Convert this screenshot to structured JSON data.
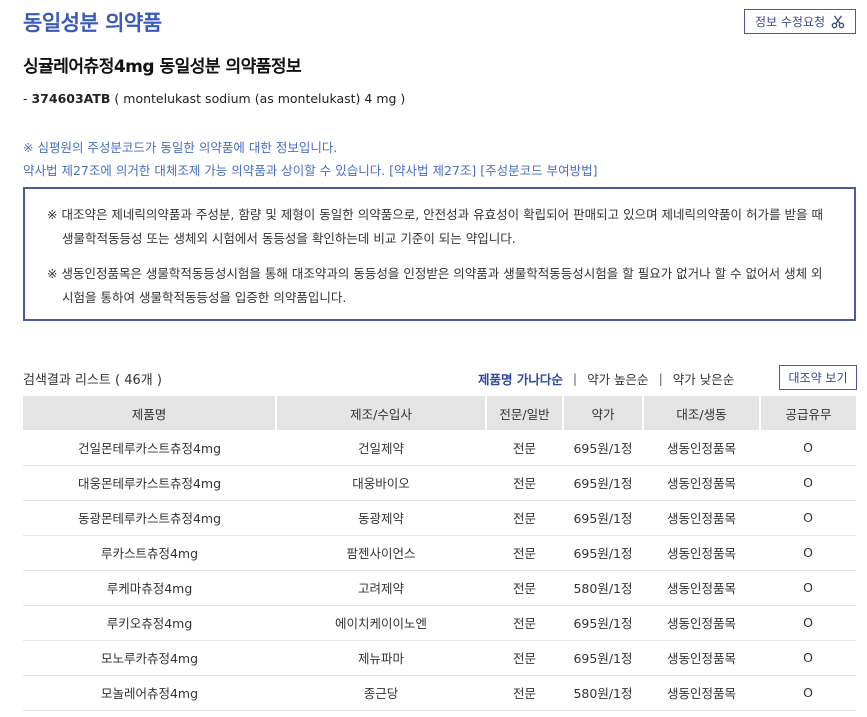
{
  "header": {
    "title": "동일성분 의약품",
    "edit_button": "정보 수정요청"
  },
  "drug": {
    "subtitle": "싱귤레어츄정4mg 동일성분 의약품정보",
    "code_prefix": "- ",
    "code": "374603ATB",
    "ingredient": " ( montelukast sodium (as montelukast) 4 mg )"
  },
  "notes": {
    "line1": "※ 심평원의 주성분코드가 동일한 의약품에 대한 정보입니다.",
    "line2": "약사법 제27조에 의거한 대체조제 가능 의약품과 상이할 수 있습니다.",
    "link1": "[약사법 제27조]",
    "link2": "[주성분코드 부여방법]"
  },
  "infobox": {
    "para1": "※ 대조약은 제네릭의약품과 주성분, 함량 및 제형이 동일한 의약품으로, 안전성과 유효성이 확립되어 판매되고 있으며 제네릭의약품이 허가를 받을 때 생물학적동등성 또는 생체외 시험에서 동등성을 확인하는데 비교 기준이 되는 약입니다.",
    "para2": "※ 생동인정품목은 생물학적동등성시험을 통해 대조약과의 동등성을 인정받은 의약품과 생물학적동등성시험을 할 필요가 없거나 할 수 없어서 생체 외 시험을 통하여 생물학적동등성을 입증한 의약품입니다."
  },
  "list": {
    "label": "검색결과 리스트 ( 46개 )",
    "sort_name": "제품명 가나다순",
    "sort_sep": "|",
    "sort_price_high": "약가 높은순",
    "sort_price_low": "약가 낮은순",
    "compare_button": "대조약 보기",
    "columns": [
      "제품명",
      "제조/수입사",
      "전문/일반",
      "약가",
      "대조/생동",
      "공급유무"
    ],
    "rows": [
      [
        "건일몬테루카스트츄정4mg",
        "건일제약",
        "전문",
        "695원/1정",
        "생동인정품목",
        "O"
      ],
      [
        "대웅몬테루카스트츄정4mg",
        "대웅바이오",
        "전문",
        "695원/1정",
        "생동인정품목",
        "O"
      ],
      [
        "동광몬테루카스트츄정4mg",
        "동광제약",
        "전문",
        "695원/1정",
        "생동인정품목",
        "O"
      ],
      [
        "루카스트츄정4mg",
        "팜젠사이언스",
        "전문",
        "695원/1정",
        "생동인정품목",
        "O"
      ],
      [
        "루케마츄정4mg",
        "고려제약",
        "전문",
        "580원/1정",
        "생동인정품목",
        "O"
      ],
      [
        "루키오츄정4mg",
        "에이치케이이노엔",
        "전문",
        "695원/1정",
        "생동인정품목",
        "O"
      ],
      [
        "모노루카츄정4mg",
        "제뉴파마",
        "전문",
        "695원/1정",
        "생동인정품목",
        "O"
      ],
      [
        "모놀레어츄정4mg",
        "종근당",
        "전문",
        "580원/1정",
        "생동인정품목",
        "O"
      ]
    ]
  }
}
